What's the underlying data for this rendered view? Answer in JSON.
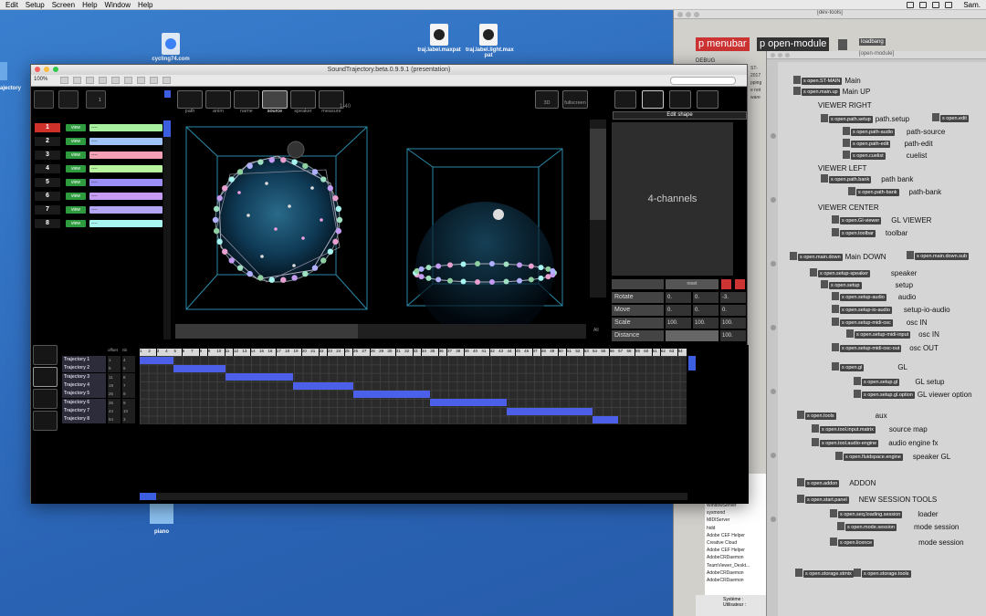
{
  "menubar": {
    "items": [
      "Edit",
      "Setup",
      "Screen",
      "Help",
      "Window",
      "Help"
    ],
    "user": "Sam."
  },
  "desktop": {
    "icons": [
      {
        "label": "traj.label.maxpat"
      },
      {
        "label": "traj.label.light.max pat"
      },
      {
        "label": "cycling74.com"
      },
      {
        "label": "piano"
      }
    ],
    "left_label": "ajectory"
  },
  "devtools": {
    "title": "[dev-tools]",
    "pmenubar": "p menubar",
    "popen": "p open-module",
    "loadbang": "loadbang",
    "debug": "DEBUG",
    "fragments": [
      "ST-",
      "2017",
      "pping",
      "e not",
      "ware"
    ],
    "processes": [
      "WindowServer",
      "sysmond",
      "MIDIServer",
      "hidd",
      "Adobe CEF Helper",
      "Creative Cloud",
      "Adobe CEF Helper",
      "AdobeCRDaemon",
      "TeamViewer_Deskt...",
      "AdobeCRDaemon",
      "AdobeCRDaemon"
    ],
    "systeme": "Système :",
    "utilisateur": "Utilisateur :"
  },
  "openmodule": {
    "title": "[open-module]",
    "entries": [
      {
        "box": "s open.ST-MAIN",
        "label": "Main"
      },
      {
        "box": "s open.main.up",
        "label": "Main UP"
      },
      {
        "head": "VIEWER RIGHT"
      },
      {
        "box": "s open.path.setup",
        "label": "path.setup"
      },
      {
        "box": "s open.edit",
        "label": ""
      },
      {
        "box": "s open.path-audio",
        "label": "path-source"
      },
      {
        "box": "s open.path-edit",
        "label": "path-edit"
      },
      {
        "box": "s open.cuelist",
        "label": "cuelist"
      },
      {
        "head": "VIEWER LEFT"
      },
      {
        "box": "s open.path.bank",
        "label": "path bank"
      },
      {
        "box": "s open.path-bank",
        "label": "path-bank"
      },
      {
        "head": "VIEWER CENTER"
      },
      {
        "box": "s open.Gl-viewer",
        "label": "GL VIEWER"
      },
      {
        "box": "s open.toolbar",
        "label": "toolbar"
      },
      {
        "box": "s open.main.down",
        "label": "Main DOWN"
      },
      {
        "box": "s open.main.down.sub",
        "label": ""
      },
      {
        "box": "s open.setup-speaker",
        "label": "speaker"
      },
      {
        "box": "s open.setup",
        "label": "setup"
      },
      {
        "box": "s open.setup-audio",
        "label": "audio"
      },
      {
        "box": "s open.setup-io-audio",
        "label": "setup-io-audio"
      },
      {
        "box": "s open.setup-midi-osc",
        "label": "osc IN"
      },
      {
        "box": "s open.setup-midi-input",
        "label": "osc IN"
      },
      {
        "box": "s open.setup-midi-osc-out",
        "label": "osc OUT"
      },
      {
        "box": "s open.gl",
        "label": "GL"
      },
      {
        "box": "s open.setup.gl",
        "label": "GL setup"
      },
      {
        "box": "s open.setup.gl.option",
        "label": "GL viewer option"
      },
      {
        "box": "s open.tools",
        "label": "aux"
      },
      {
        "box": "s open.tool.input.matrix",
        "label": "source map"
      },
      {
        "box": "s open.tool.audio-engine",
        "label": "audio engine fx"
      },
      {
        "box": "s open.fluidspace.engine",
        "label": "speaker GL"
      },
      {
        "box": "s open.addon",
        "label": "ADDON"
      },
      {
        "box": "s open.start.panel",
        "label": "NEW SESSION TOOLS"
      },
      {
        "box": "s open.seq.loading.session",
        "label": "loader"
      },
      {
        "box": "s open.mode.session",
        "label": "mode session"
      },
      {
        "box": "s open.licence",
        "label": "mode session"
      },
      {
        "box": "s open.storage.stmix",
        "label": ""
      },
      {
        "box": "s open.storage.tools",
        "label": ""
      }
    ]
  },
  "mainwin": {
    "title": "SoundTrajectory.beta.0.9.9.1 (presentation)",
    "zoom": "100%",
    "tabs": [
      {
        "label": "path",
        "selected": false
      },
      {
        "label": "anim",
        "selected": false
      },
      {
        "label": "name",
        "selected": false
      },
      {
        "label": "source",
        "selected": true
      },
      {
        "label": "speaker",
        "selected": false
      },
      {
        "label": "measure",
        "selected": false
      }
    ],
    "after_tabs": "1-40",
    "view_buttons": [
      {
        "label": "3D"
      },
      {
        "label": "fullscreen"
      }
    ],
    "list_header": "1",
    "trajectories": [
      {
        "num": "1",
        "view": "view",
        "bar": "----",
        "color": "#a6f0a0",
        "selected": true
      },
      {
        "num": "2",
        "view": "view",
        "bar": "----",
        "color": "#9fc3f7",
        "selected": false
      },
      {
        "num": "3",
        "view": "view",
        "bar": "----",
        "color": "#f5a0b4",
        "selected": false
      },
      {
        "num": "4",
        "view": "view",
        "bar": "----",
        "color": "#b8f59e",
        "selected": false
      },
      {
        "num": "5",
        "view": "view",
        "bar": "----",
        "color": "#9a8ff2",
        "selected": false
      },
      {
        "num": "6",
        "view": "view",
        "bar": "----",
        "color": "#c59cf2",
        "selected": false
      },
      {
        "num": "7",
        "view": "view",
        "bar": "----",
        "color": "#b3a6f5",
        "selected": false
      },
      {
        "num": "8",
        "view": "view",
        "bar": "----",
        "color": "#a8f5f0",
        "selected": false
      }
    ],
    "edit_shape": "Edit shape",
    "channels": "4-channels",
    "reset": "reset",
    "controls": [
      {
        "label": "Rotate",
        "values": [
          "0.",
          "0.",
          "-3."
        ]
      },
      {
        "label": "Move",
        "values": [
          "0.",
          "0.",
          "0."
        ]
      },
      {
        "label": "Scale",
        "values": [
          "100.",
          "100.",
          "100."
        ]
      },
      {
        "label": "Distance",
        "values": [
          "",
          "",
          "100."
        ]
      }
    ],
    "all_label": "All",
    "timeline": {
      "header_offset": "offset",
      "header_nb": "nb",
      "columns": 64,
      "rows": [
        {
          "name": "Trajectory 1",
          "offset": "1",
          "nb": "4",
          "start": 1,
          "length": 4
        },
        {
          "name": "Trajectory 2",
          "offset": "5",
          "nb": "6",
          "start": 5,
          "length": 6
        },
        {
          "name": "Trajectory 3",
          "offset": "11",
          "nb": "8",
          "start": 11,
          "length": 8
        },
        {
          "name": "Trajectory 4",
          "offset": "19",
          "nb": "7",
          "start": 19,
          "length": 7
        },
        {
          "name": "Trajectory 5",
          "offset": "26",
          "nb": "9",
          "start": 26,
          "length": 9
        },
        {
          "name": "Trajectory 6",
          "offset": "35",
          "nb": "9",
          "start": 35,
          "length": 9
        },
        {
          "name": "Trajectory 7",
          "offset": "44",
          "nb": "10",
          "start": 44,
          "length": 10
        },
        {
          "name": "Trajectory 8",
          "offset": "54",
          "nb": "3",
          "start": 54,
          "length": 3
        }
      ]
    }
  }
}
